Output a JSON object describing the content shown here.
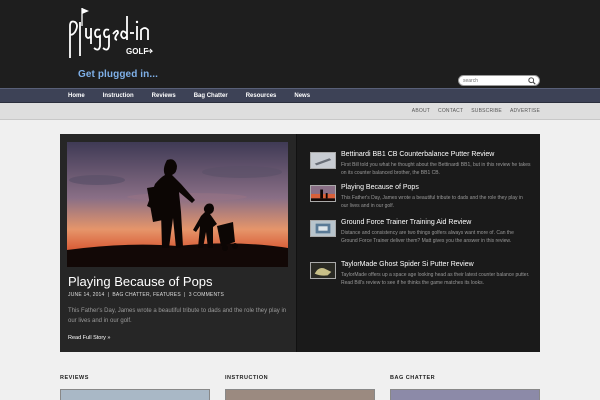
{
  "header": {
    "logo_alt": "plugged-in golf",
    "tagline": "Get plugged in...",
    "search_placeholder": "search"
  },
  "nav": {
    "items": [
      "Home",
      "Instruction",
      "Reviews",
      "Bag Chatter",
      "Resources",
      "News"
    ]
  },
  "secondary_nav": {
    "items": [
      "ABOUT",
      "CONTACT",
      "SUBSCRIBE",
      "ADVERTISE"
    ]
  },
  "featured": {
    "title": "Playing Because of Pops",
    "date": "JUNE 14, 2014",
    "categories": "BAG CHATTER, FEATURES",
    "comments": "3 COMMENTS",
    "excerpt": "This Father's Day, James wrote a beautiful tribute to dads and the role they play in our lives and in our golf.",
    "read_more": "Read Full Story »"
  },
  "stories": [
    {
      "title": "Bettinardi BB1 CB Counterbalance Putter Review",
      "desc": "First Bill told you what he thought about the Bettinardi BB1, but in this review he takes on its counter balanced brother, the BB1 CB.",
      "icon": "putter-thumb"
    },
    {
      "title": "Playing Because of Pops",
      "desc": "This Father's Day, James wrote a beautiful tribute to dads and the role they play in our lives and in our golf.",
      "icon": "sunset-thumb"
    },
    {
      "title": "Ground Force Trainer Training Aid Review",
      "desc": "Distance and consistency are two things golfers always want more of. Can the Ground Force Trainer deliver them? Matt gives you the answer in this review.",
      "icon": "trainer-thumb"
    },
    {
      "title": "TaylorMade Ghost Spider Si Putter Review",
      "desc": "TaylorMade offers up a space age looking head as their latest counter balance putter. Read Bill's review to see if he thinks the game matches its looks.",
      "icon": "putter-head-thumb"
    }
  ],
  "sections": [
    {
      "heading": "REVIEWS"
    },
    {
      "heading": "INSTRUCTION"
    },
    {
      "heading": "BAG CHATTER"
    }
  ],
  "colors": {
    "header_bg": "#1e1e1e",
    "nav_bg": "#3d4256",
    "tagline": "#7fb0e8",
    "panel_bg": "#2a2a2a"
  }
}
